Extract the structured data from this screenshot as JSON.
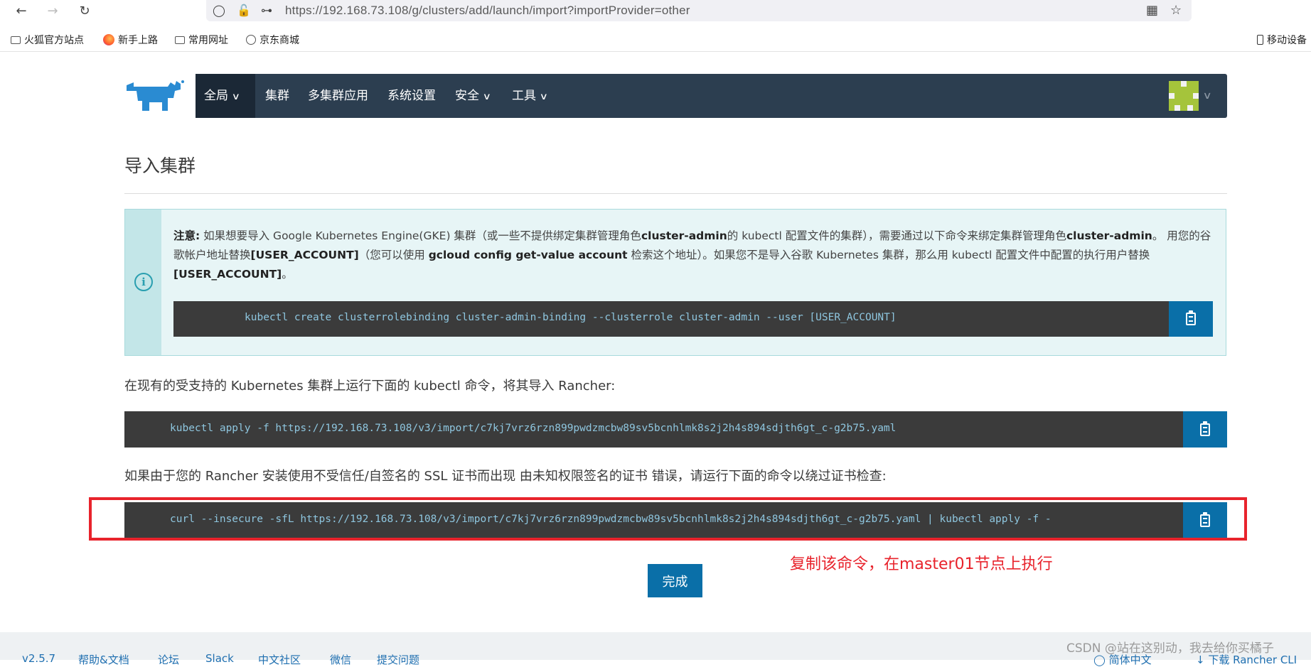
{
  "browser": {
    "url": "https://192.168.73.108/g/clusters/add/launch/import?importProvider=other",
    "bookmarks": [
      "火狐官方站点",
      "新手上路",
      "常用网址",
      "京东商城"
    ],
    "mobile": "移动设备"
  },
  "nav": {
    "global": "全局",
    "items": [
      "集群",
      "多集群应用",
      "系统设置",
      "安全",
      "工具"
    ]
  },
  "page": {
    "title": "导入集群",
    "note_label": "注意:",
    "note_1": " 如果想要导入 Google Kubernetes Engine(GKE) 集群（或一些不提供绑定集群管理角色",
    "note_b1": "cluster-admin",
    "note_2": "的 kubectl 配置文件的集群），需要通过以下命令来绑定集群管理角色",
    "note_b2": "cluster-admin",
    "note_3": "。 用您的谷歌帐户地址替换",
    "note_b3": "[USER_ACCOUNT]",
    "note_4": "（您可以使用 ",
    "note_b4": "gcloud config get-value account",
    "note_5": " 检索这个地址）。如果您不是导入谷歌 Kubernetes 集群，那么用 kubectl 配置文件中配置的执行用户替换",
    "note_b5": "[USER_ACCOUNT]",
    "note_6": "。",
    "cmd_binding": "kubectl create clusterrolebinding cluster-admin-binding --clusterrole cluster-admin --user [USER_ACCOUNT]",
    "para_1": "在现有的受支持的 Kubernetes 集群上运行下面的 kubectl 命令，将其导入 Rancher:",
    "cmd_apply": "kubectl apply -f https://192.168.73.108/v3/import/c7kj7vrz6rzn899pwdzmcbw89sv5bcnhlmk8s2j2h4s894sdjth6gt_c-g2b75.yaml",
    "para_2": "如果由于您的 Rancher 安装使用不受信任/自签名的 SSL 证书而出现 由未知权限签名的证书 错误，请运行下面的命令以绕过证书检查:",
    "cmd_curl": "curl --insecure -sfL https://192.168.73.108/v3/import/c7kj7vrz6rzn899pwdzmcbw89sv5bcnhlmk8s2j2h4s894sdjth6gt_c-g2b75.yaml | kubectl apply -f -",
    "annotation": "复制该命令，在master01节点上执行",
    "done": "完成"
  },
  "footer": {
    "links": [
      "v2.5.7",
      "帮助&文档",
      "论坛",
      "Slack",
      "中文社区",
      "微信",
      "提交问题"
    ],
    "lang": "简体中文",
    "download": "下载 Rancher CLI",
    "watermark": "CSDN @站在这别动，我去给你买橘子"
  },
  "colors": {
    "nav_bg": "#2c3e50",
    "accent": "#0a6fa8",
    "annotation": "#e8232c"
  }
}
